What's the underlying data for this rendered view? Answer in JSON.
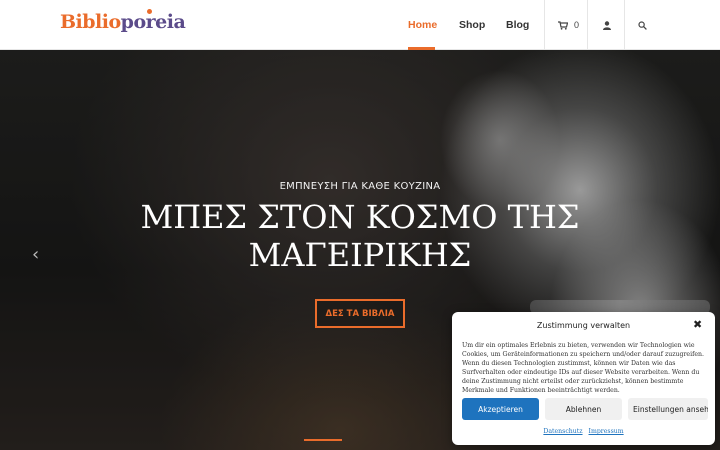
{
  "header": {
    "logo_part1": "Biblio",
    "logo_part2": "poreia",
    "nav": [
      "Home",
      "Shop",
      "Blog"
    ],
    "active_nav": "Home",
    "cart_count": "0",
    "colors": {
      "accent": "#ea6c2b",
      "logo_secondary": "#5b4b8a"
    }
  },
  "hero": {
    "subtitle": "ΕΜΠΝΕΥΣΗ ΓΙΑ ΚΑΘΕ ΚΟΥΖΙΝΑ",
    "title_line1": "ΜΠΕΣ ΣΤΟΝ ΚΟΣΜΟ ΤΗΣ",
    "title_line2": "ΜΑΓΕΙΡΙΚΗΣ",
    "cta_label": "ΔΕΣ ΤΑ ΒΙΒΛΙΑ",
    "prev_arrow": "‹"
  },
  "consent": {
    "title": "Zustimmung verwalten",
    "close": "✖",
    "text": "Um dir ein optimales Erlebnis zu bieten, verwenden wir Technologien wie Cookies, um Geräteinformationen zu speichern und/oder darauf zuzugreifen. Wenn du diesen Technologien zustimmst, können wir Daten wie das Surfverhalten oder eindeutige IDs auf dieser Website verarbeiten. Wenn du deine Zustimmung nicht erteilst oder zurückziehst, können bestimmte Merkmale und Funktionen beeinträchtigt werden.",
    "accept": "Akzeptieren",
    "deny": "Ablehnen",
    "settings": "Einstellungen ansehen",
    "links": [
      "Datenschutz",
      "Impressum"
    ],
    "colors": {
      "accept_bg": "#1e73be"
    }
  },
  "icons": {
    "cart": "cart-icon",
    "user": "user-icon",
    "search": "search-icon"
  }
}
